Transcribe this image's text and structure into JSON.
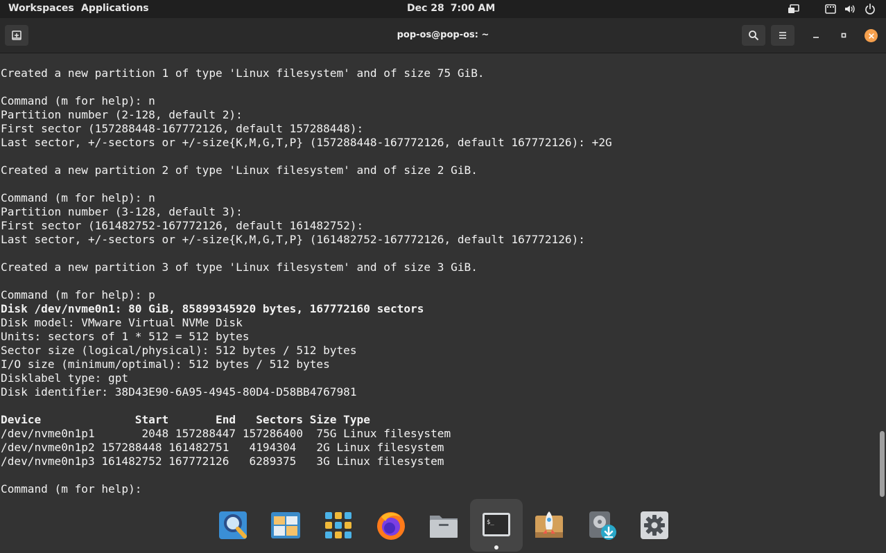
{
  "top_panel": {
    "workspaces_label": "Workspaces",
    "applications_label": "Applications",
    "date": "Dec 28",
    "time": "7:00 AM"
  },
  "window": {
    "title": "pop-os@pop-os: ~",
    "close_color": "#f6a04d"
  },
  "terminal": {
    "lines": [
      {
        "text": "Created a new partition 1 of type 'Linux filesystem' and of size 75 GiB.",
        "bold": false
      },
      {
        "text": "",
        "bold": false
      },
      {
        "text": "Command (m for help): n",
        "bold": false
      },
      {
        "text": "Partition number (2-128, default 2):",
        "bold": false
      },
      {
        "text": "First sector (157288448-167772126, default 157288448):",
        "bold": false
      },
      {
        "text": "Last sector, +/-sectors or +/-size{K,M,G,T,P} (157288448-167772126, default 167772126): +2G",
        "bold": false
      },
      {
        "text": "",
        "bold": false
      },
      {
        "text": "Created a new partition 2 of type 'Linux filesystem' and of size 2 GiB.",
        "bold": false
      },
      {
        "text": "",
        "bold": false
      },
      {
        "text": "Command (m for help): n",
        "bold": false
      },
      {
        "text": "Partition number (3-128, default 3):",
        "bold": false
      },
      {
        "text": "First sector (161482752-167772126, default 161482752):",
        "bold": false
      },
      {
        "text": "Last sector, +/-sectors or +/-size{K,M,G,T,P} (161482752-167772126, default 167772126):",
        "bold": false
      },
      {
        "text": "",
        "bold": false
      },
      {
        "text": "Created a new partition 3 of type 'Linux filesystem' and of size 3 GiB.",
        "bold": false
      },
      {
        "text": "",
        "bold": false
      },
      {
        "text": "Command (m for help): p",
        "bold": false
      },
      {
        "text": "Disk /dev/nvme0n1: 80 GiB, 85899345920 bytes, 167772160 sectors",
        "bold": true
      },
      {
        "text": "Disk model: VMware Virtual NVMe Disk",
        "bold": false
      },
      {
        "text": "Units: sectors of 1 * 512 = 512 bytes",
        "bold": false
      },
      {
        "text": "Sector size (logical/physical): 512 bytes / 512 bytes",
        "bold": false
      },
      {
        "text": "I/O size (minimum/optimal): 512 bytes / 512 bytes",
        "bold": false
      },
      {
        "text": "Disklabel type: gpt",
        "bold": false
      },
      {
        "text": "Disk identifier: 38D43E90-6A95-4945-80D4-D58BB4767981",
        "bold": false
      },
      {
        "text": "",
        "bold": false
      },
      {
        "text": "Device              Start       End   Sectors Size Type",
        "bold": true
      },
      {
        "text": "/dev/nvme0n1p1       2048 157288447 157286400  75G Linux filesystem",
        "bold": false
      },
      {
        "text": "/dev/nvme0n1p2 157288448 161482751   4194304   2G Linux filesystem",
        "bold": false
      },
      {
        "text": "/dev/nvme0n1p3 161482752 167772126   6289375   3G Linux filesystem",
        "bold": false
      },
      {
        "text": "",
        "bold": false
      },
      {
        "text": "Command (m for help): ",
        "bold": false
      }
    ]
  },
  "dock": {
    "items": [
      {
        "name": "search-app",
        "icon": "magnifier-icon",
        "active": false
      },
      {
        "name": "files-app-alt",
        "icon": "window-tiles-icon",
        "active": false
      },
      {
        "name": "app-grid",
        "icon": "app-grid-icon",
        "active": false
      },
      {
        "name": "firefox",
        "icon": "firefox-icon",
        "active": false
      },
      {
        "name": "files",
        "icon": "folder-icon",
        "active": false
      },
      {
        "name": "terminal",
        "icon": "terminal-icon",
        "active": true
      },
      {
        "name": "pop-shop",
        "icon": "rocket-icon",
        "active": false
      },
      {
        "name": "disk-installer",
        "icon": "disk-download-icon",
        "active": false
      },
      {
        "name": "settings",
        "icon": "gear-icon",
        "active": false
      }
    ]
  },
  "colors": {
    "panel_bg": "#1f1f1f",
    "header_bg": "#2a2a2a",
    "terminal_bg": "#333333",
    "terminal_fg": "#f2f2f2",
    "accent": "#f6a04d"
  }
}
